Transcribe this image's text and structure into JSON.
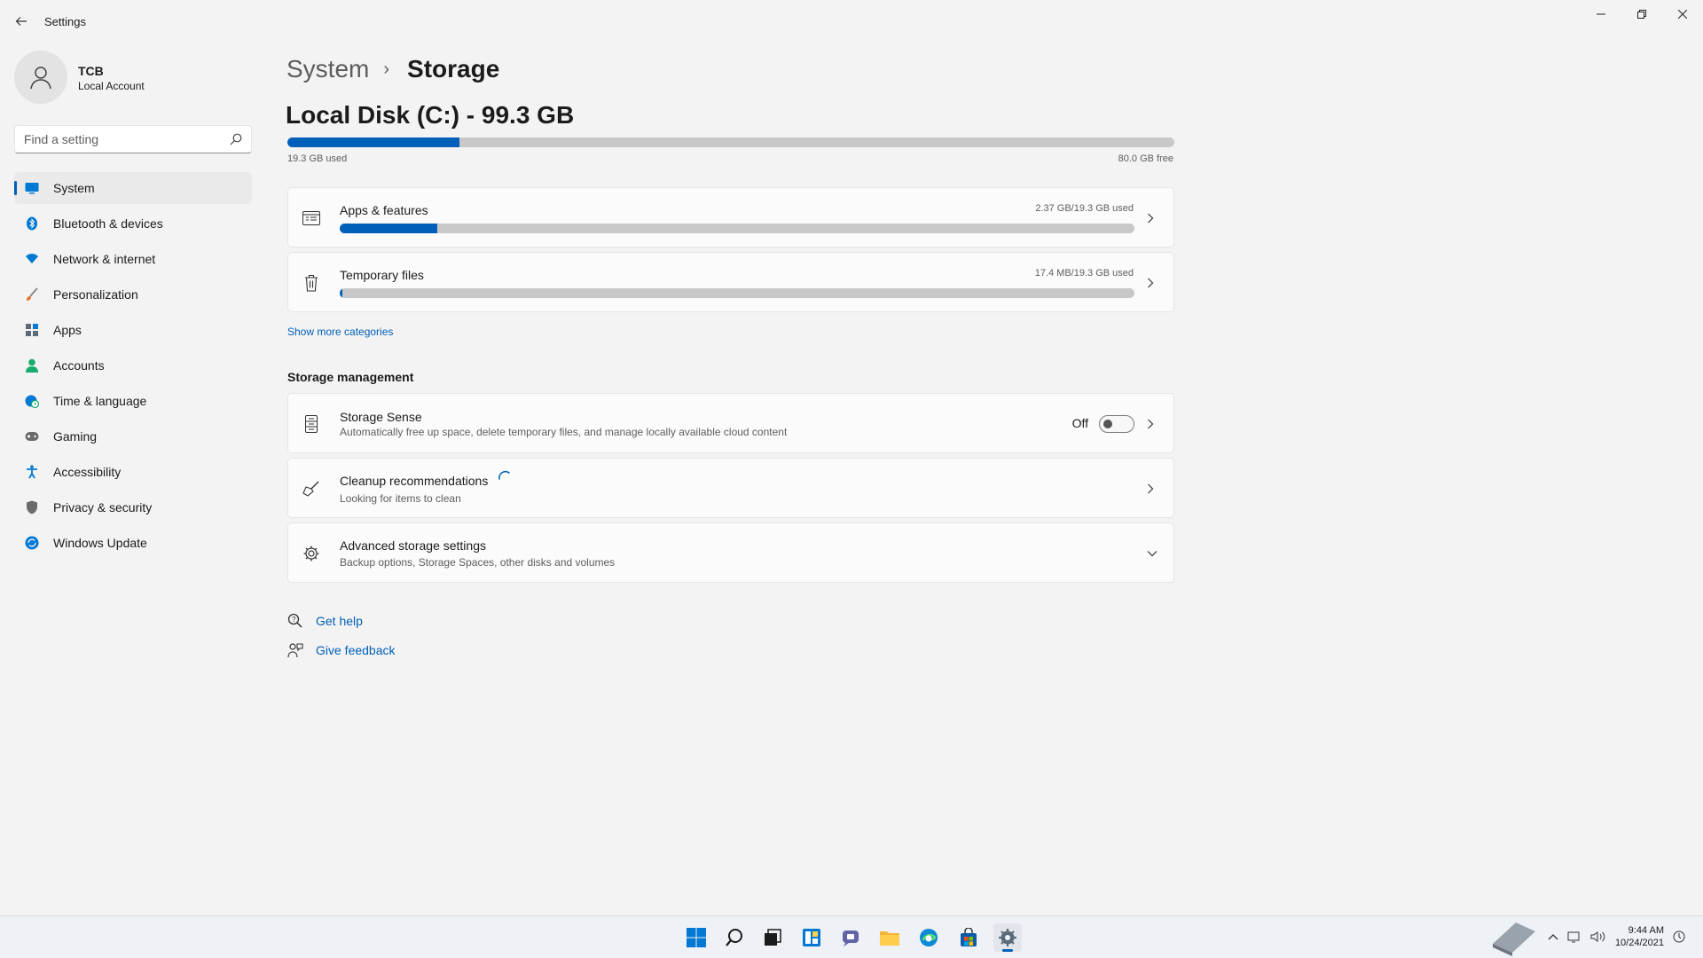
{
  "window": {
    "title": "Settings",
    "controls": [
      "minimize",
      "maximize",
      "close"
    ]
  },
  "profile": {
    "name": "TCB",
    "type": "Local Account"
  },
  "search": {
    "placeholder": "Find a setting"
  },
  "sidebar": {
    "items": [
      {
        "label": "System",
        "icon": "system-icon",
        "active": true,
        "color": "#0078d4"
      },
      {
        "label": "Bluetooth & devices",
        "icon": "bluetooth-icon",
        "color": "#0078d4"
      },
      {
        "label": "Network & internet",
        "icon": "wifi-icon",
        "color": "#0078d4"
      },
      {
        "label": "Personalization",
        "icon": "brush-icon",
        "color": "#e8702a"
      },
      {
        "label": "Apps",
        "icon": "apps-icon",
        "color": "#5b6b7c"
      },
      {
        "label": "Accounts",
        "icon": "person-icon",
        "color": "#1aab6e"
      },
      {
        "label": "Time & language",
        "icon": "globe-clock-icon",
        "color": "#0078d4"
      },
      {
        "label": "Gaming",
        "icon": "gamepad-icon",
        "color": "#6b6b6b"
      },
      {
        "label": "Accessibility",
        "icon": "accessibility-icon",
        "color": "#0078d4"
      },
      {
        "label": "Privacy & security",
        "icon": "shield-icon",
        "color": "#6b6b6b"
      },
      {
        "label": "Windows Update",
        "icon": "update-icon",
        "color": "#0078d4"
      }
    ]
  },
  "breadcrumb": {
    "parent": "System",
    "separator": "›",
    "current": "Storage"
  },
  "disk": {
    "title": "Local Disk (C:) - 99.3 GB",
    "used_label": "19.3 GB used",
    "free_label": "80.0 GB free",
    "used_fraction": 0.194
  },
  "categories": [
    {
      "title": "Apps & features",
      "usage": "2.37 GB/19.3 GB used",
      "fraction": 0.123,
      "icon": "apps-features-icon"
    },
    {
      "title": "Temporary files",
      "usage": "17.4 MB/19.3 GB used",
      "fraction": 0.001,
      "icon": "trash-icon"
    }
  ],
  "show_more": "Show more categories",
  "storage_management": {
    "heading": "Storage management",
    "storage_sense": {
      "title": "Storage Sense",
      "subtitle": "Automatically free up space, delete temporary files, and manage locally available cloud content",
      "toggle_label": "Off",
      "toggle_on": false
    },
    "cleanup": {
      "title": "Cleanup recommendations",
      "subtitle": "Looking for items to clean"
    },
    "advanced": {
      "title": "Advanced storage settings",
      "subtitle": "Backup options, Storage Spaces, other disks and volumes"
    }
  },
  "help": {
    "get_help": "Get help",
    "give_feedback": "Give feedback"
  },
  "taskbar": {
    "icons": [
      "windows-start-icon",
      "search-icon",
      "task-view-icon",
      "widgets-icon",
      "chat-icon",
      "file-explorer-icon",
      "edge-icon",
      "store-icon",
      "settings-icon"
    ],
    "active": "settings-icon",
    "time": "9:44 AM",
    "date": "10/24/2021",
    "watermark": "TheCollectionBook"
  },
  "colors": {
    "accent": "#005fb8",
    "background": "#f3f3f3",
    "card": "#fbfbfb"
  }
}
